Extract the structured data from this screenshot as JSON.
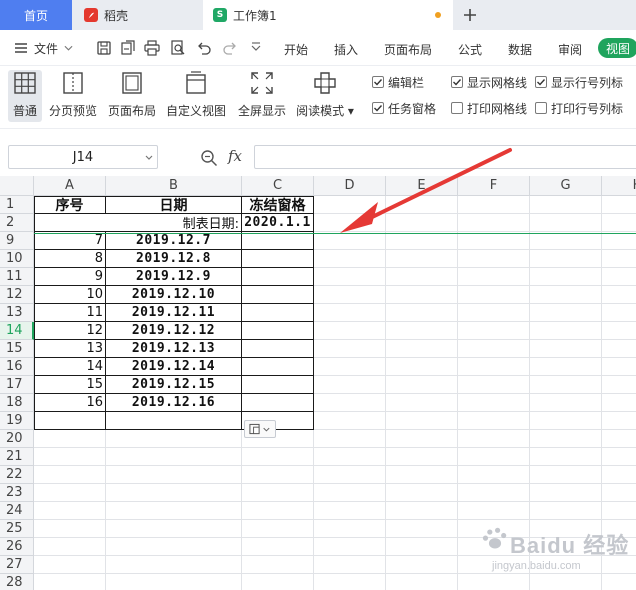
{
  "tabs": {
    "home": "首页",
    "daoke": "稻壳",
    "workbook": "工作簿1",
    "workbook_logo": "S"
  },
  "menu": {
    "file": "文件",
    "items": [
      "开始",
      "插入",
      "页面布局",
      "公式",
      "数据",
      "审阅"
    ],
    "view": "视图"
  },
  "ribbon": {
    "buttons": [
      "普通",
      "分页预览",
      "页面布局",
      "自定义视图",
      "全屏显示",
      "阅读模式"
    ],
    "checkboxes": [
      {
        "label": "编辑栏",
        "checked": true
      },
      {
        "label": "显示网格线",
        "checked": true
      },
      {
        "label": "显示行号列标",
        "checked": true
      },
      {
        "label": "任务窗格",
        "checked": true
      },
      {
        "label": "打印网格线",
        "checked": false
      },
      {
        "label": "打印行号列标",
        "checked": false
      }
    ]
  },
  "formula_bar": {
    "name_box": "J14",
    "fx": "fx",
    "formula": ""
  },
  "sheet": {
    "columns": [
      "A",
      "B",
      "C",
      "D",
      "E",
      "F",
      "G",
      "H"
    ],
    "row_headers": [
      "1",
      "2",
      "9",
      "10",
      "11",
      "12",
      "13",
      "14",
      "15",
      "16",
      "17",
      "18",
      "19",
      "20",
      "21",
      "22",
      "23",
      "24",
      "25",
      "26",
      "27",
      "28"
    ],
    "selected_row": "14",
    "header_row": {
      "a": "序号",
      "b": "日期",
      "c": "冻结窗格"
    },
    "row2": {
      "label": "制表日期:",
      "value": "2020.1.1"
    },
    "data_rows": [
      {
        "a": "7",
        "b": "2019.12.7"
      },
      {
        "a": "8",
        "b": "2019.12.8"
      },
      {
        "a": "9",
        "b": "2019.12.9"
      },
      {
        "a": "10",
        "b": "2019.12.10"
      },
      {
        "a": "11",
        "b": "2019.12.11"
      },
      {
        "a": "12",
        "b": "2019.12.12"
      },
      {
        "a": "13",
        "b": "2019.12.13"
      },
      {
        "a": "14",
        "b": "2019.12.14"
      },
      {
        "a": "15",
        "b": "2019.12.15"
      },
      {
        "a": "16",
        "b": "2019.12.16"
      }
    ]
  },
  "watermark": {
    "brand": "Baidu 经验",
    "url": "jingyan.baidu.com"
  },
  "colors": {
    "tab_active": "#4f7ef0",
    "view_tab": "#1fa45d",
    "freeze_line": "#1fa45d",
    "annotation_arrow": "#e53935"
  }
}
